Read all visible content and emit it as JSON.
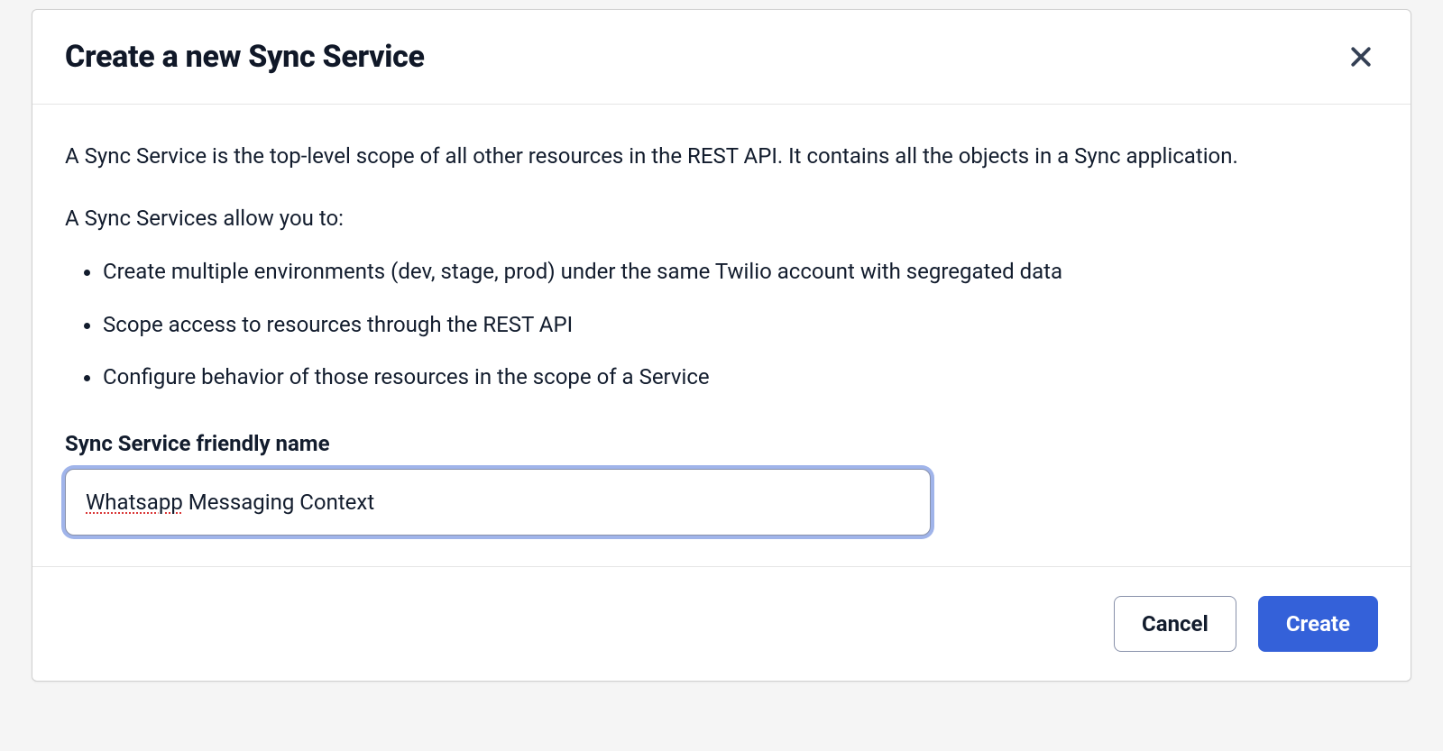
{
  "dialog": {
    "title": "Create a new Sync Service",
    "intro": "A Sync Service is the top-level scope of all other resources in the REST API. It contains all the objects in a Sync application.",
    "subhead": "A Sync Services allow you to:",
    "bullets": [
      "Create multiple environments (dev, stage, prod) under the same Twilio account with segregated data",
      "Scope access to resources through the REST API",
      "Configure behavior of those resources in the scope of a Service"
    ],
    "field": {
      "label": "Sync Service friendly name",
      "value": "Whatsapp Messaging Context",
      "value_prefix_spell": "Whatsapp",
      "value_rest": " Messaging Context"
    },
    "footer": {
      "cancel": "Cancel",
      "create": "Create"
    }
  }
}
